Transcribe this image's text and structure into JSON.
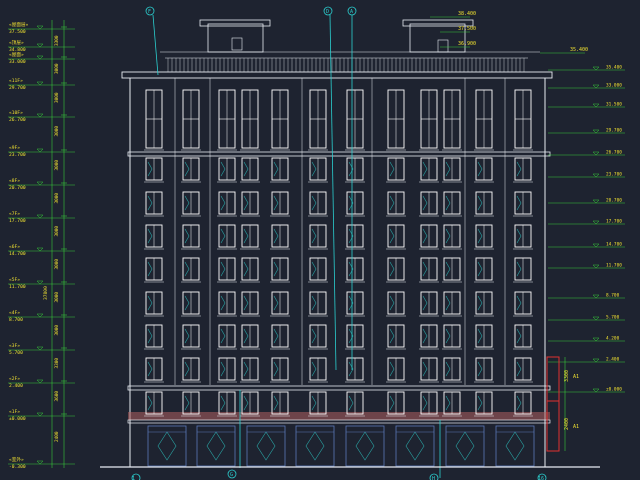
{
  "colors": {
    "background": "#1e2330",
    "building_line": "#e8ecf2",
    "window_frame": "#ffffff",
    "window_glass": "#2aa7a7",
    "dimension": "#36c93a",
    "level_text": "#f0e130",
    "grid_axis": "#2bd0d0",
    "red_line": "#e03030",
    "storefront": "#5a78b8",
    "brick_band": "#b06060"
  },
  "top_labels": {
    "roof_peak_right": "38.400",
    "roof_mech_right_top": "37.500",
    "roof_mech_right_low": "36.900",
    "parapet_right": "35.400"
  },
  "left_levels": [
    {
      "tag": "«屋面层»",
      "value": "37.500"
    },
    {
      "tag": "«顶层»",
      "value": "34.800"
    },
    {
      "tag": "«屋面»",
      "value": "33.000"
    },
    {
      "tag": "«11F»",
      "value": "29.700"
    },
    {
      "tag": "«10F»",
      "value": "26.700"
    },
    {
      "tag": "«9F»",
      "value": "23.700"
    },
    {
      "tag": "«8F»",
      "value": "20.700"
    },
    {
      "tag": "«7F»",
      "value": "17.700"
    },
    {
      "tag": "«6F»",
      "value": "14.700"
    },
    {
      "tag": "«5F»",
      "value": "11.700"
    },
    {
      "tag": "«4F»",
      "value": "8.700"
    },
    {
      "tag": "«3F»",
      "value": "5.700"
    },
    {
      "tag": "«2F»",
      "value": "2.400"
    },
    {
      "tag": "«1F»",
      "value": "±0.000"
    },
    {
      "tag": "«室外»",
      "value": "-0.300"
    }
  ],
  "left_dims": [
    "3300",
    "3000",
    "3000",
    "3000",
    "3000",
    "3000",
    "3000",
    "3000",
    "3000",
    "3000",
    "3300",
    "3600",
    "2400"
  ],
  "left_total": "37800",
  "right_levels": [
    "35.400",
    "33.000",
    "31.500",
    "29.700",
    "26.700",
    "23.700",
    "20.700",
    "17.700",
    "14.700",
    "11.700",
    "8.700",
    "5.700",
    "4.200",
    "2.400",
    "±0.000"
  ],
  "right_dims": [
    "3300",
    "2400"
  ],
  "right_tags": [
    "A1",
    "A1"
  ],
  "grid_bubbles": {
    "top": [
      "F",
      "D",
      "A"
    ],
    "bottom": [
      "G",
      "H",
      "C"
    ]
  },
  "axis_numbers": {
    "left": "1",
    "right": "16"
  }
}
